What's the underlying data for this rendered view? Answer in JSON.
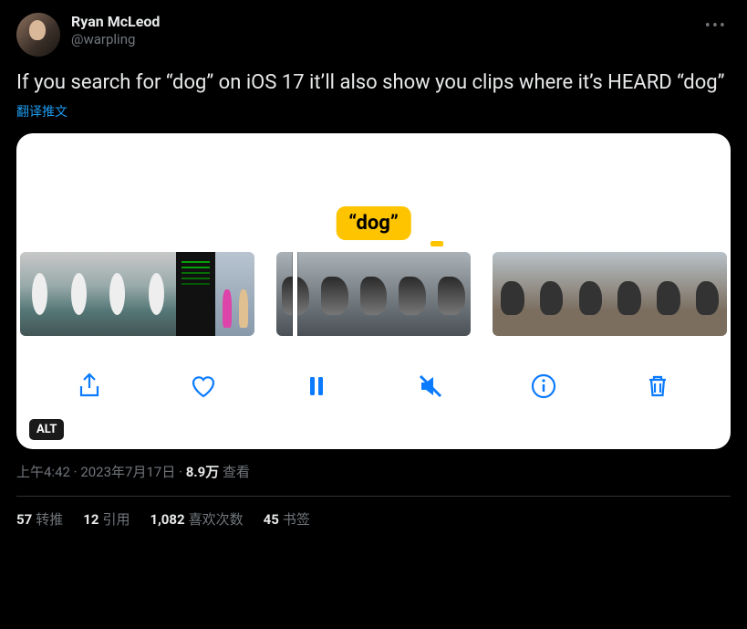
{
  "user": {
    "display_name": "Ryan McLeod",
    "handle": "@warpling"
  },
  "body": "If you search for “dog” on iOS 17 it’ll also show you clips where it’s HEARD “dog”",
  "translate": "翻译推文",
  "media": {
    "caption": "“dog”",
    "alt_badge": "ALT"
  },
  "meta": {
    "time": "上午4:42",
    "sep1": " · ",
    "date": "2023年7月17日",
    "sep2": " · ",
    "views_value": "8.9万",
    "views_label": " 查看"
  },
  "stats": {
    "retweet_count": "57",
    "retweet_label": "转推",
    "quote_count": "12",
    "quote_label": "引用",
    "like_count": "1,082",
    "like_label": "喜欢次数",
    "bookmark_count": "45",
    "bookmark_label": "书签"
  }
}
